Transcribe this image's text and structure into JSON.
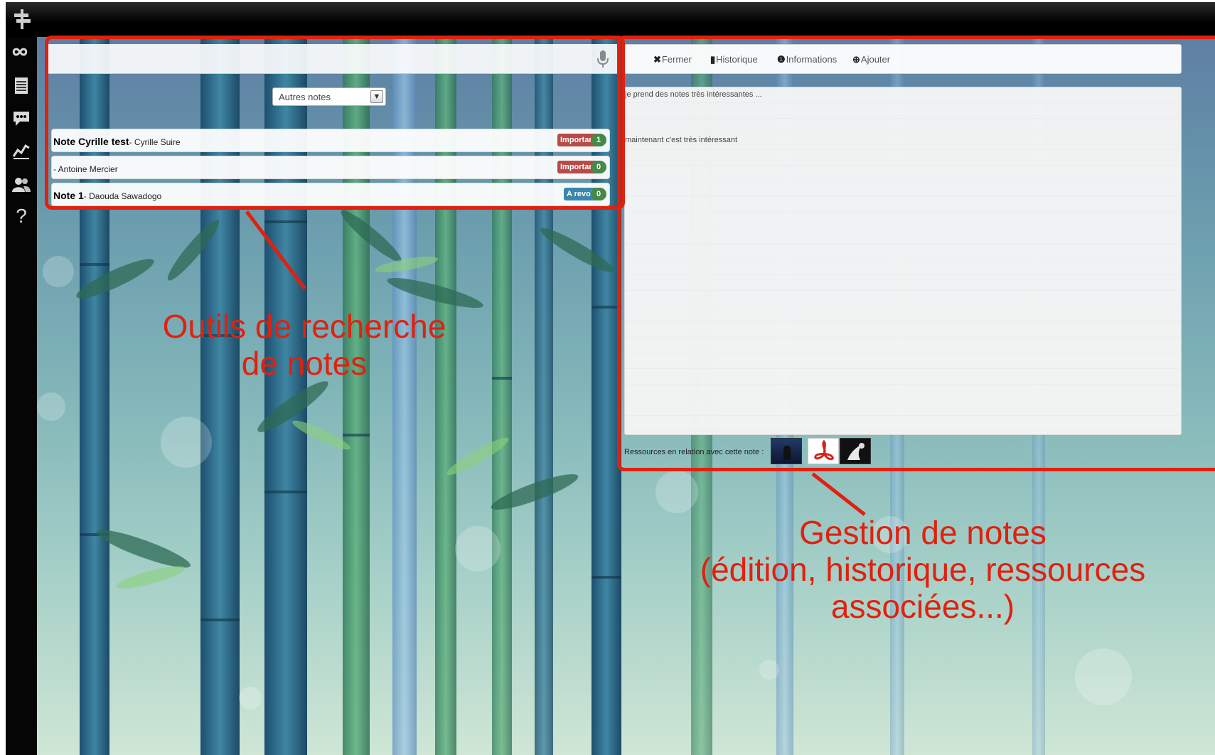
{
  "app": {
    "sidebar": {
      "items": [
        {
          "icon": "infinity-icon"
        },
        {
          "icon": "notepad-icon"
        },
        {
          "icon": "chat-icon"
        },
        {
          "icon": "chart-icon"
        },
        {
          "icon": "users-icon"
        },
        {
          "icon": "help-icon",
          "label": "?"
        }
      ]
    }
  },
  "search": {
    "filter": {
      "selected": "Autres notes"
    },
    "notes": [
      {
        "title": "Note Cyrille test",
        "author": "- Cyrille Suire",
        "badge": "Important",
        "badge_type": "important",
        "count": "1"
      },
      {
        "title": "",
        "author": "- Antoine Mercier",
        "badge": "Important",
        "badge_type": "important",
        "count": "0"
      },
      {
        "title": "Note 1",
        "author": "- Daouda Sawadogo",
        "badge": "A revoir",
        "badge_type": "revoir",
        "count": "0"
      }
    ]
  },
  "editor": {
    "toolbar": {
      "close_icon": "✖",
      "close": "Fermer",
      "history_icon": "▮",
      "history": "Historique",
      "info_icon": "❶",
      "info": "Informations",
      "add_icon": "⊕",
      "add": "Ajouter"
    },
    "content": {
      "line1": "je prend des notes très intéressantes ...",
      "line2": "maintenant c'est très intéressant"
    },
    "resources": {
      "label": "Ressources en relation avec cette note :",
      "items": [
        "video-thumbnail",
        "pdf-icon",
        "image-thumbnail"
      ]
    }
  },
  "annotations": {
    "search_tools": [
      "Outils de recherche",
      "de notes"
    ],
    "note_management": [
      "Gestion de notes",
      "(édition, historique, ressources",
      "associées...)"
    ],
    "color": "#e0210f"
  }
}
